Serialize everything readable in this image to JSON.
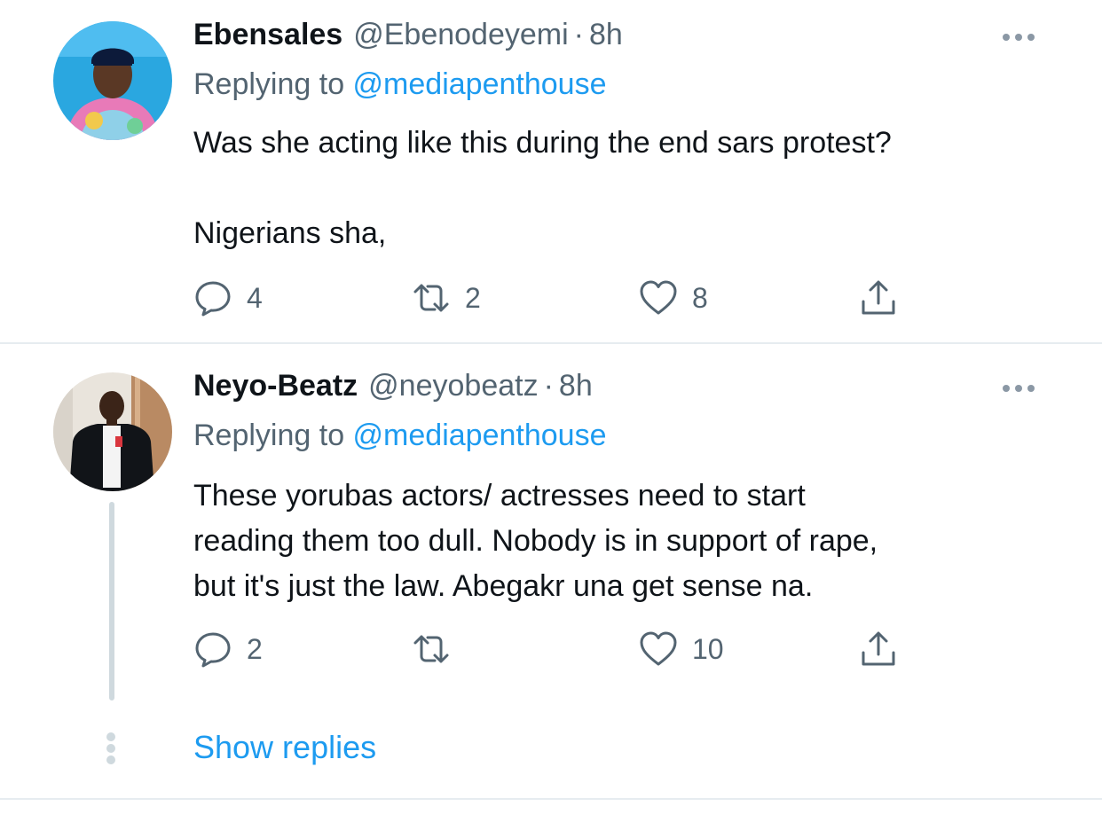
{
  "tweets": [
    {
      "name": "Ebensales",
      "handle": "@Ebenodeyemi",
      "separator": "·",
      "time": "8h",
      "replying_prefix": "Replying to ",
      "replying_to": "@mediapenthouse",
      "text": "Was she acting like this during the end sars protest?\n\nNigerians sha,",
      "replies": "4",
      "retweets": "2",
      "likes": "8"
    },
    {
      "name": "Neyo-Beatz",
      "handle": "@neyobeatz",
      "separator": "·",
      "time": "8h",
      "replying_prefix": "Replying to ",
      "replying_to": "@mediapenthouse",
      "text": "These yorubas actors/ actresses need to start\nreading them too dull. Nobody is in support of rape,\nbut it's just the law. Abegakr una get sense na.",
      "replies": "2",
      "retweets": "",
      "likes": "10"
    }
  ],
  "show_replies": "Show replies",
  "icons": [
    "reply-icon",
    "retweet-icon",
    "like-icon",
    "share-icon",
    "more-icon"
  ],
  "colors": {
    "link": "#1d9bf0",
    "secondary": "#536471",
    "text": "#0f1419",
    "divider": "#e6ecf0"
  }
}
